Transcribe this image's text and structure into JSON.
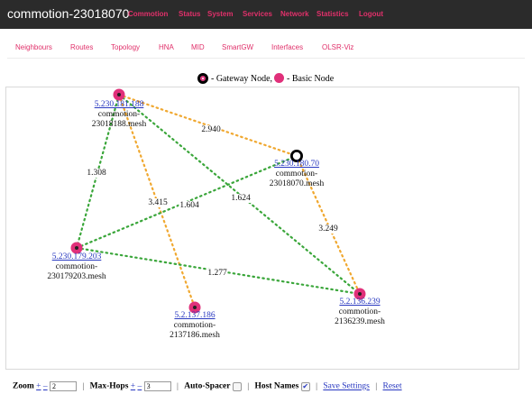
{
  "header": {
    "title": "commotion-23018070",
    "nav": [
      "Commotion",
      "Status",
      "System",
      "Services",
      "Network",
      "Statistics",
      "Logout"
    ]
  },
  "subnav": [
    "Neighbours",
    "Routes",
    "Topology",
    "HNA",
    "MID",
    "SmartGW",
    "Interfaces",
    "OLSR-Viz"
  ],
  "legend": {
    "gateway_label": "- Gateway Node,",
    "basic_label": "- Basic Node"
  },
  "nodes": [
    {
      "ip": "5.230.181.188",
      "host": [
        "commotion-",
        "23018188.mesh"
      ],
      "type": "basic"
    },
    {
      "ip": "5.230.180.70",
      "host": [
        "commotion-",
        "23018070.mesh"
      ],
      "type": "gateway"
    },
    {
      "ip": "5.230.179.203",
      "host": [
        "commotion-",
        "230179203.mesh"
      ],
      "type": "basic"
    },
    {
      "ip": "5.2.137.186",
      "host": [
        "commotion-",
        "2137186.mesh"
      ],
      "type": "basic"
    },
    {
      "ip": "5.2.136.239",
      "host": [
        "commotion-",
        "2136239.mesh"
      ],
      "type": "basic"
    }
  ],
  "links": [
    {
      "from": 0,
      "to": 1,
      "quality": "orange",
      "weight": "2.940"
    },
    {
      "from": 0,
      "to": 2,
      "quality": "green",
      "weight": "1.308"
    },
    {
      "from": 0,
      "to": 3,
      "quality": "orange",
      "weight": "3.415"
    },
    {
      "from": 0,
      "to": 4,
      "quality": "green",
      "weight": "1.624"
    },
    {
      "from": 2,
      "to": 1,
      "quality": "green",
      "weight": "1.604"
    },
    {
      "from": 1,
      "to": 4,
      "quality": "orange",
      "weight": "3.249"
    },
    {
      "from": 2,
      "to": 4,
      "quality": "green",
      "weight": "1.277"
    }
  ],
  "colors": {
    "green": "#3aa63a",
    "orange": "#f0a830",
    "node_pink": "#e0307a",
    "accent": "#e0306a"
  },
  "controls": {
    "zoom_label": "Zoom",
    "zoom_plus": "+",
    "zoom_minus": "–",
    "zoom_value": "2",
    "hops_label": "Max-Hops",
    "hops_plus": "+",
    "hops_minus": "–",
    "hops_value": "3",
    "spacer_label": "Auto-Spacer",
    "hostnames_label": "Host Names",
    "hostnames_checked": "✔",
    "save_label": "Save Settings",
    "reset_label": "Reset"
  }
}
